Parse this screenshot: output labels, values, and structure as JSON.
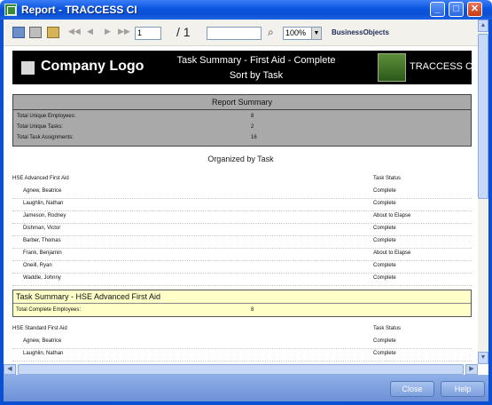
{
  "window": {
    "title": "Report - TRACCESS CI",
    "minimize_glyph": "_",
    "maximize_glyph": "□",
    "close_glyph": "✕"
  },
  "toolbar": {
    "page_value": "1",
    "page_total": "/ 1",
    "search_value": "",
    "zoom": "100%",
    "zoom_arrow": "▼",
    "brand_label": "BusinessObjects",
    "nav": {
      "first": "◀◀",
      "prev": "◀",
      "next": "▶",
      "last": "▶▶"
    },
    "binoculars": "⌕"
  },
  "header": {
    "company_logo": "Company Logo",
    "title": "Task Summary - First Aid - Complete",
    "subtitle": "Sort by Task",
    "brand": "TRACCESS CI"
  },
  "report_summary": {
    "heading": "Report Summary",
    "rows": [
      {
        "label": "Total Unique Employees:",
        "value": "8"
      },
      {
        "label": "Total Unique Tasks:",
        "value": "2"
      },
      {
        "label": "Total Task Assignments:",
        "value": "16"
      }
    ]
  },
  "organized_label": "Organized by Task",
  "groups": [
    {
      "name": "HSE  Advanced First Aid",
      "status_header": "Task Status",
      "rows": [
        {
          "name": "Agnew, Beatrice",
          "status": "Complete"
        },
        {
          "name": "Laughlin, Nathan",
          "status": "Complete"
        },
        {
          "name": "Jameson, Rodney",
          "status": "About to Elapse"
        },
        {
          "name": "Dishman, Victor",
          "status": "Complete"
        },
        {
          "name": "Barber, Thomas",
          "status": "Complete"
        },
        {
          "name": "Frank, Benjamin",
          "status": "About to Elapse"
        },
        {
          "name": "Oneill, Ryan",
          "status": "Complete"
        },
        {
          "name": "Waddle, Johnny",
          "status": "Complete"
        }
      ],
      "summary": {
        "title": "Task Summary - HSE  Advanced First Aid",
        "label": "Total Complete Employees:",
        "value": "8"
      }
    },
    {
      "name": "HSE  Standard First Aid",
      "status_header": "Task Status",
      "rows": [
        {
          "name": "Agnew, Beatrice",
          "status": "Complete"
        },
        {
          "name": "Laughlin, Nathan",
          "status": "Complete"
        }
      ]
    }
  ],
  "scrollbars": {
    "up": "▲",
    "down": "▼",
    "left": "◀",
    "right": "▶"
  },
  "buttons": {
    "close": "Close",
    "help": "Help"
  }
}
